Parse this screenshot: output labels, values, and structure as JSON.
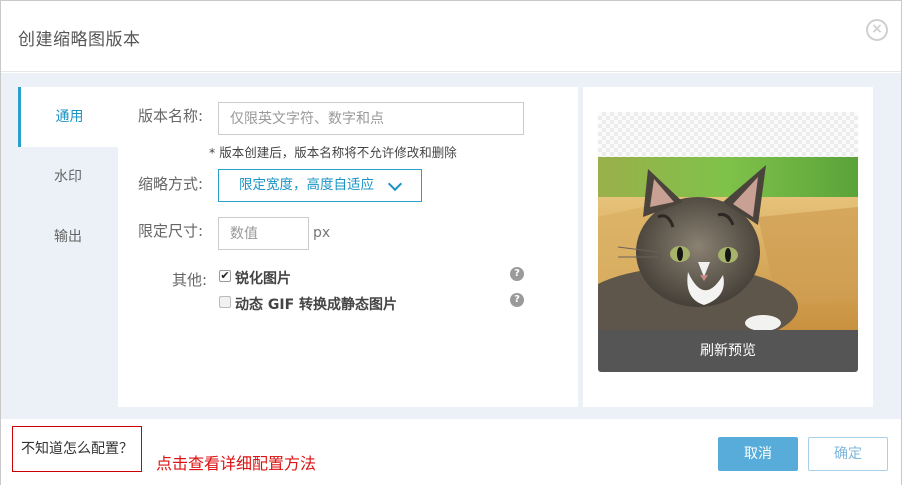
{
  "dialog": {
    "title": "创建缩略图版本",
    "close_glyph": "×"
  },
  "nav": {
    "items": [
      {
        "label": "通用",
        "active": true
      },
      {
        "label": "水印",
        "active": false
      },
      {
        "label": "输出",
        "active": false
      }
    ]
  },
  "form": {
    "name_label": "版本名称:",
    "name_value": "",
    "name_placeholder": "仅限英文字符、数字和点",
    "name_hint": "* 版本创建后，版本名称将不允许修改和删除",
    "mode_label": "缩略方式:",
    "mode_value": "限定宽度，高度自适应",
    "size_label": "限定尺寸:",
    "size_value": "",
    "size_placeholder": "数值",
    "size_unit": "px",
    "other_label": "其他:",
    "options": [
      {
        "label": "锐化图片",
        "checked": true,
        "help": "?"
      },
      {
        "label": "动态 GIF 转换成静态图片",
        "checked": false,
        "help": "?"
      }
    ]
  },
  "preview": {
    "refresh_label": "刷新预览"
  },
  "footer": {
    "howto_label": "不知道怎么配置？",
    "note": "点击查看详细配置方法",
    "cancel_label": "取消",
    "ok_label": "确定"
  },
  "colors": {
    "accent": "#2aa0d0",
    "cancel_bg": "#58acd9",
    "note_red": "#dd1111"
  },
  "icons": {
    "close": "close-icon",
    "dropdown": "chevron-down-icon",
    "help": "help-icon",
    "checkbox": "checkbox-icon"
  }
}
